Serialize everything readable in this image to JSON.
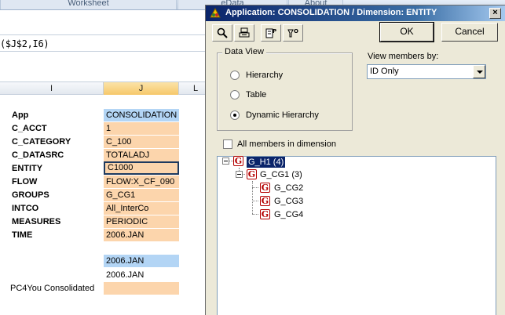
{
  "excel": {
    "ribbon_tabs": [
      "Worksheet",
      "eData",
      "About"
    ],
    "formula_text": "($J$2,I6)",
    "columns": [
      "I",
      "J",
      "L"
    ],
    "labels": [
      "App",
      "C_ACCT",
      "C_CATEGORY",
      "C_DATASRC",
      "ENTITY",
      "FLOW",
      "GROUPS",
      "INTCO",
      "MEASURES",
      "TIME"
    ],
    "values": [
      "CONSOLIDATION",
      "1",
      "C_100",
      "TOTALADJ",
      "C1000",
      "FLOW:X_CF_090",
      "G_CG1",
      "All_InterCo",
      "PERIODIC",
      "2006.JAN"
    ],
    "time_header": "2006.JAN",
    "time_value": "2006.JAN",
    "bottom_label": "PC4You Consolidated"
  },
  "dialog": {
    "title": "Application: CONSOLIDATION / Dimension: ENTITY",
    "close_glyph": "×",
    "ok_label": "OK",
    "cancel_label": "Cancel",
    "toolbar_icons": [
      "zoom-icon",
      "properties-icon",
      "member-properties-icon",
      "filter-icon"
    ],
    "data_view": {
      "title": "Data View",
      "options": [
        "Hierarchy",
        "Table",
        "Dynamic Hierarchy"
      ],
      "selected": "Dynamic Hierarchy"
    },
    "view_members_by": {
      "label": "View members by:",
      "selected": "ID Only"
    },
    "all_members_label": "All members in dimension",
    "all_members_checked": false,
    "tree": [
      {
        "label": "G_H1 (4)",
        "level": 0,
        "selected": true
      },
      {
        "label": "G_CG1 (3)",
        "level": 1,
        "selected": false
      },
      {
        "label": "G_CG2",
        "level": 2,
        "selected": false
      },
      {
        "label": "G_CG3",
        "level": 2,
        "selected": false
      },
      {
        "label": "G_CG4",
        "level": 2,
        "selected": false
      }
    ],
    "node_icon_glyph": "G"
  }
}
